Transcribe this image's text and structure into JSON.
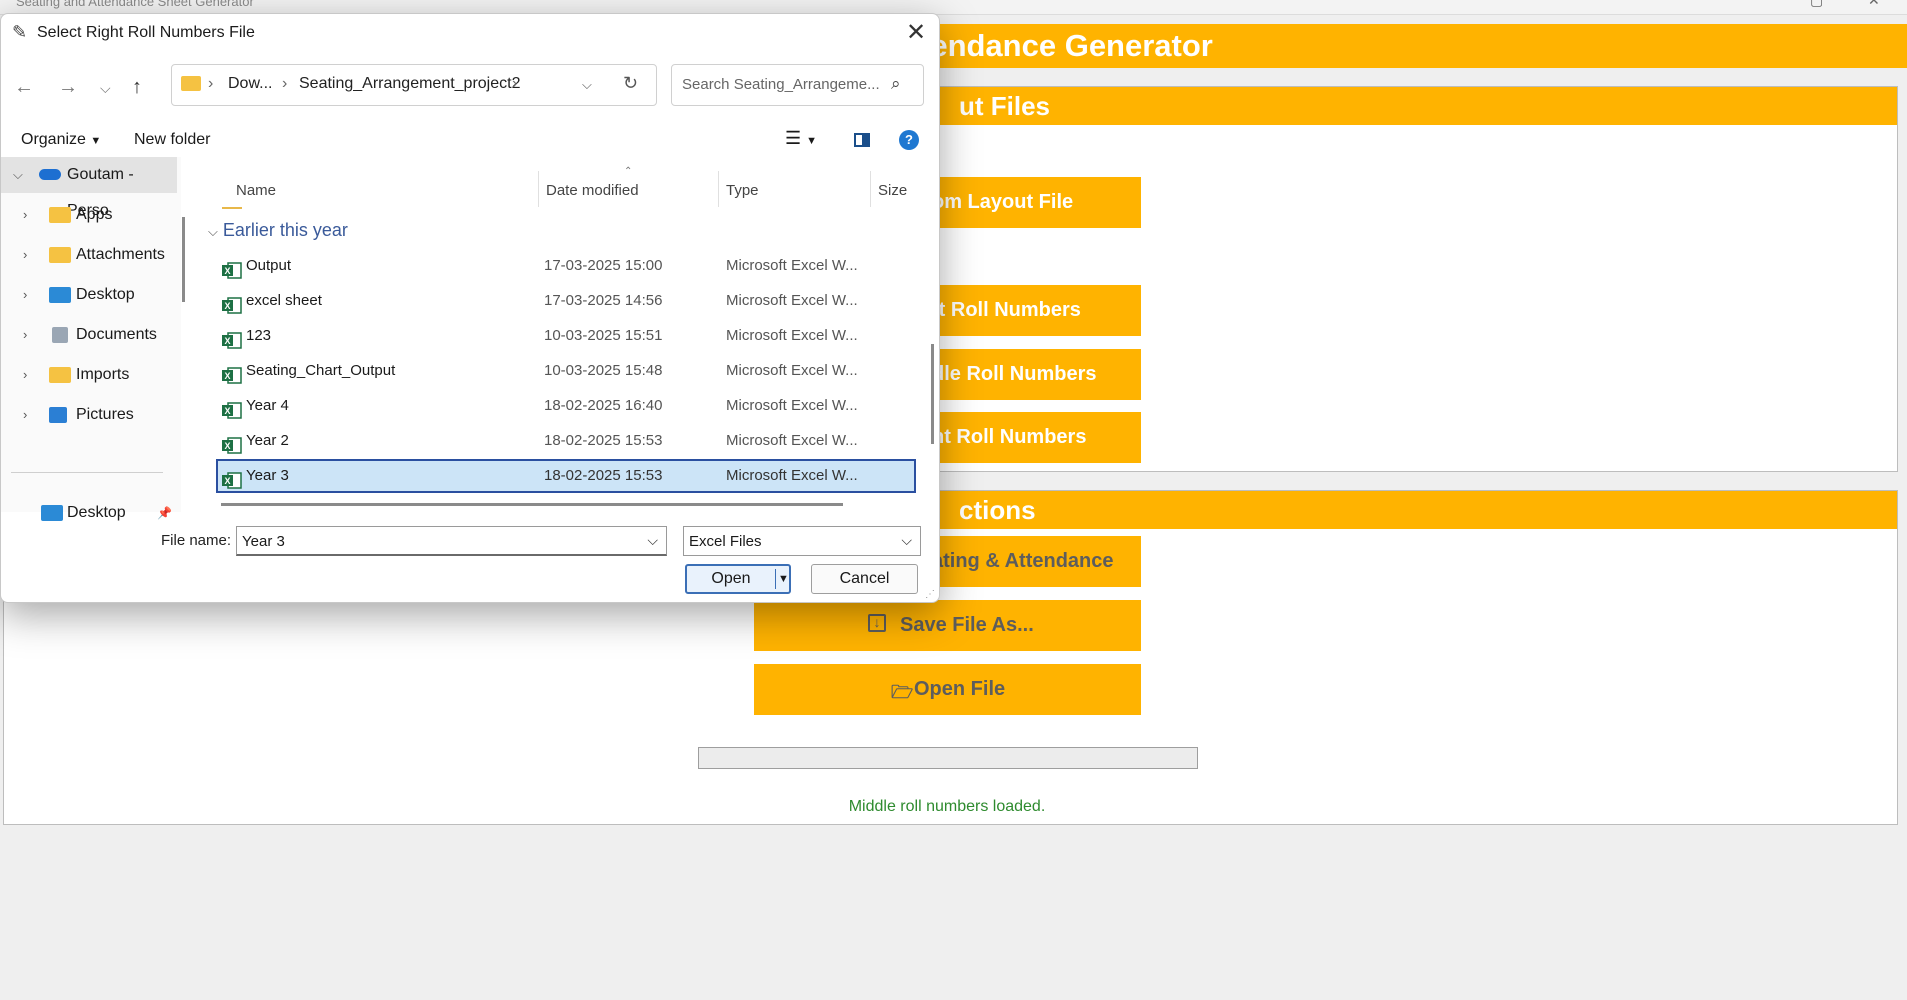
{
  "app": {
    "window_title": "Seating and Attendance Sheet Generator",
    "main_title": "tendance Generator",
    "input_section_title": "ut Files",
    "actions_section_title": "ctions",
    "buttons": {
      "room_layout": "om Layout File",
      "left_roll": "ft Roll Numbers",
      "middle_roll": "dle Roll Numbers",
      "right_roll": "ht Roll Numbers",
      "generate": "ating & Attendance",
      "save_as": "Save File As...",
      "open_file": "Open File"
    },
    "status": "Middle roll numbers loaded.",
    "progress": 0,
    "colors": {
      "accent": "#ffb300",
      "status": "#2e8b2e"
    }
  },
  "dialog": {
    "title": "Select Right Roll Numbers File",
    "address": {
      "segments": [
        "Dow...",
        "Seating_Arrangement_project2"
      ]
    },
    "search_placeholder": "Search Seating_Arrangeme...",
    "toolbar": {
      "organize": "Organize",
      "new_folder": "New folder"
    },
    "sidebar": {
      "items": [
        {
          "label": "Goutam - Perso",
          "icon": "cloud-icon"
        },
        {
          "label": "Apps",
          "icon": "folder-icon"
        },
        {
          "label": "Attachments",
          "icon": "folder-icon"
        },
        {
          "label": "Desktop",
          "icon": "desktop-icon"
        },
        {
          "label": "Documents",
          "icon": "documents-icon"
        },
        {
          "label": "Imports",
          "icon": "folder-icon"
        },
        {
          "label": "Pictures",
          "icon": "pictures-icon"
        }
      ],
      "pinned": "Desktop"
    },
    "columns": {
      "name": "Name",
      "date": "Date modified",
      "type": "Type",
      "size": "Size"
    },
    "group": "Earlier this year",
    "files": [
      {
        "name": "Output",
        "date": "17-03-2025 15:00",
        "type": "Microsoft Excel W..."
      },
      {
        "name": "excel sheet",
        "date": "17-03-2025 14:56",
        "type": "Microsoft Excel W..."
      },
      {
        "name": "123",
        "date": "10-03-2025 15:51",
        "type": "Microsoft Excel W..."
      },
      {
        "name": "Seating_Chart_Output",
        "date": "10-03-2025 15:48",
        "type": "Microsoft Excel W..."
      },
      {
        "name": "Year 4",
        "date": "18-02-2025 16:40",
        "type": "Microsoft Excel W..."
      },
      {
        "name": "Year 2",
        "date": "18-02-2025 15:53",
        "type": "Microsoft Excel W..."
      },
      {
        "name": "Year 3",
        "date": "18-02-2025 15:53",
        "type": "Microsoft Excel W..."
      }
    ],
    "file_name_label": "File name:",
    "file_name_value": "Year 3",
    "file_type_value": "Excel Files",
    "open_label": "Open",
    "cancel_label": "Cancel"
  }
}
